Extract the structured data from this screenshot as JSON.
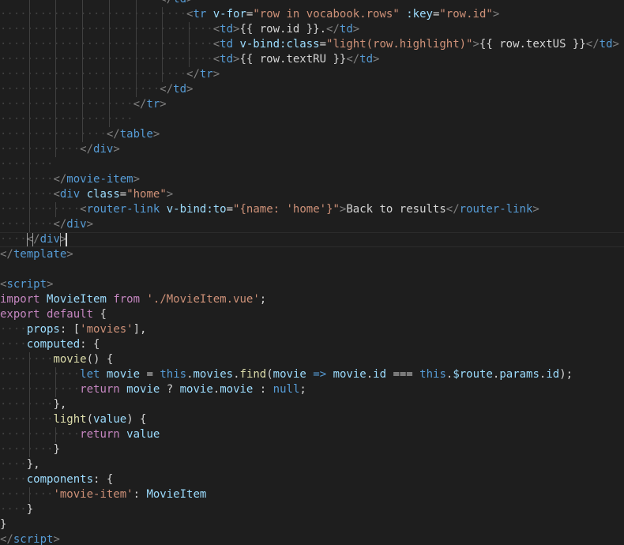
{
  "editor": {
    "language": "vue",
    "lines": [
      {
        "indent": 6,
        "tokens": [
          [
            "</",
            "tpunc"
          ],
          [
            "td",
            "ttag"
          ],
          [
            ">",
            "tpunc"
          ]
        ]
      },
      {
        "indent": 7,
        "tokens": [
          [
            "<",
            "tpunc"
          ],
          [
            "tr",
            "ttag"
          ],
          [
            " ",
            "ttxt"
          ],
          [
            "v-for",
            "tattr"
          ],
          [
            "=",
            "ttxt"
          ],
          [
            "\"row in vocabook.rows\"",
            "tstr"
          ],
          [
            " ",
            "ttxt"
          ],
          [
            ":key",
            "tattr"
          ],
          [
            "=",
            "ttxt"
          ],
          [
            "\"row.id\"",
            "tstr"
          ],
          [
            ">",
            "tpunc"
          ]
        ]
      },
      {
        "indent": 8,
        "tokens": [
          [
            "<",
            "tpunc"
          ],
          [
            "td",
            "ttag"
          ],
          [
            ">",
            "tpunc"
          ],
          [
            "{{ row.id }}.",
            "ttxt"
          ],
          [
            "</",
            "tpunc"
          ],
          [
            "td",
            "ttag"
          ],
          [
            ">",
            "tpunc"
          ]
        ]
      },
      {
        "indent": 8,
        "tokens": [
          [
            "<",
            "tpunc"
          ],
          [
            "td",
            "ttag"
          ],
          [
            " ",
            "ttxt"
          ],
          [
            "v-bind:class",
            "tattr"
          ],
          [
            "=",
            "ttxt"
          ],
          [
            "\"light(row.highlight)\"",
            "tstr"
          ],
          [
            ">",
            "tpunc"
          ],
          [
            "{{ row.textUS }}",
            "ttxt"
          ],
          [
            "</",
            "tpunc"
          ],
          [
            "td",
            "ttag"
          ],
          [
            ">",
            "tpunc"
          ]
        ]
      },
      {
        "indent": 8,
        "tokens": [
          [
            "<",
            "tpunc"
          ],
          [
            "td",
            "ttag"
          ],
          [
            ">",
            "tpunc"
          ],
          [
            "{{ row.textRU }}",
            "ttxt"
          ],
          [
            "</",
            "tpunc"
          ],
          [
            "td",
            "ttag"
          ],
          [
            ">",
            "tpunc"
          ]
        ]
      },
      {
        "indent": 7,
        "tokens": [
          [
            "</",
            "tpunc"
          ],
          [
            "tr",
            "ttag"
          ],
          [
            ">",
            "tpunc"
          ]
        ]
      },
      {
        "indent": 6,
        "tokens": [
          [
            "</",
            "tpunc"
          ],
          [
            "td",
            "ttag"
          ],
          [
            ">",
            "tpunc"
          ]
        ]
      },
      {
        "indent": 5,
        "tokens": [
          [
            "</",
            "tpunc"
          ],
          [
            "tr",
            "ttag"
          ],
          [
            ">",
            "tpunc"
          ]
        ]
      },
      {
        "indent": 5,
        "tokens": []
      },
      {
        "indent": 4,
        "tokens": [
          [
            "</",
            "tpunc"
          ],
          [
            "table",
            "ttag"
          ],
          [
            ">",
            "tpunc"
          ]
        ]
      },
      {
        "indent": 3,
        "tokens": [
          [
            "</",
            "tpunc"
          ],
          [
            "div",
            "ttag"
          ],
          [
            ">",
            "tpunc"
          ]
        ]
      },
      {
        "indent": 2,
        "tokens": []
      },
      {
        "indent": 2,
        "tokens": [
          [
            "</",
            "tpunc"
          ],
          [
            "movie-item",
            "ttag"
          ],
          [
            ">",
            "tpunc"
          ]
        ]
      },
      {
        "indent": 2,
        "tokens": [
          [
            "<",
            "tpunc"
          ],
          [
            "div",
            "ttag"
          ],
          [
            " ",
            "ttxt"
          ],
          [
            "class",
            "tattr"
          ],
          [
            "=",
            "ttxt"
          ],
          [
            "\"home\"",
            "tstr"
          ],
          [
            ">",
            "tpunc"
          ]
        ]
      },
      {
        "indent": 3,
        "tokens": [
          [
            "<",
            "tpunc"
          ],
          [
            "router-link",
            "ttag"
          ],
          [
            " ",
            "ttxt"
          ],
          [
            "v-bind:to",
            "tattr"
          ],
          [
            "=",
            "ttxt"
          ],
          [
            "\"{name: ",
            "tstr"
          ],
          [
            "'home'",
            "tstr"
          ],
          [
            "}\"",
            "tstr"
          ],
          [
            ">",
            "tpunc"
          ],
          [
            "Back to results",
            "ttxt"
          ],
          [
            "</",
            "tpunc"
          ],
          [
            "router-link",
            "ttag"
          ],
          [
            ">",
            "tpunc"
          ]
        ]
      },
      {
        "indent": 2,
        "tokens": [
          [
            "</",
            "tpunc"
          ],
          [
            "div",
            "ttag"
          ],
          [
            ">",
            "tpunc"
          ]
        ]
      },
      {
        "indent": 1,
        "active": true,
        "tokens": [
          [
            "</",
            "tpunc",
            "box"
          ],
          [
            "div",
            "ttag"
          ],
          [
            ">",
            "tpunc",
            "box-cursor"
          ]
        ]
      },
      {
        "indent": 0,
        "tokens": [
          [
            "</",
            "tpunc"
          ],
          [
            "template",
            "ttag"
          ],
          [
            ">",
            "tpunc"
          ]
        ]
      },
      {
        "indent": 0,
        "tokens": []
      },
      {
        "indent": 0,
        "tokens": [
          [
            "<",
            "tpunc"
          ],
          [
            "script",
            "ttag"
          ],
          [
            ">",
            "tpunc"
          ]
        ]
      },
      {
        "indent": 0,
        "tokens": [
          [
            "import",
            "tctl"
          ],
          [
            " ",
            "ttxt"
          ],
          [
            "MovieItem",
            "tvar"
          ],
          [
            " ",
            "ttxt"
          ],
          [
            "from",
            "tctl"
          ],
          [
            " ",
            "ttxt"
          ],
          [
            "'./MovieItem.vue'",
            "tstr"
          ],
          [
            ";",
            "ttxt"
          ]
        ]
      },
      {
        "indent": 0,
        "tokens": [
          [
            "export",
            "tctl"
          ],
          [
            " ",
            "ttxt"
          ],
          [
            "default",
            "tctl"
          ],
          [
            " {",
            "ttxt"
          ]
        ]
      },
      {
        "indent": 1,
        "tokens": [
          [
            "props",
            "tvar"
          ],
          [
            ": [",
            "ttxt"
          ],
          [
            "'movies'",
            "tstr"
          ],
          [
            "],",
            "ttxt"
          ]
        ]
      },
      {
        "indent": 1,
        "tokens": [
          [
            "computed",
            "tvar"
          ],
          [
            ": {",
            "ttxt"
          ]
        ]
      },
      {
        "indent": 2,
        "tokens": [
          [
            "movie",
            "tfn"
          ],
          [
            "() {",
            "ttxt"
          ]
        ]
      },
      {
        "indent": 3,
        "tokens": [
          [
            "let",
            "tkw"
          ],
          [
            " ",
            "ttxt"
          ],
          [
            "movie",
            "tvar"
          ],
          [
            " = ",
            "ttxt"
          ],
          [
            "this",
            "tkw"
          ],
          [
            ".",
            "ttxt"
          ],
          [
            "movies",
            "tvar"
          ],
          [
            ".",
            "ttxt"
          ],
          [
            "find",
            "tfn"
          ],
          [
            "(",
            "ttxt"
          ],
          [
            "movie",
            "tvar"
          ],
          [
            " ",
            "ttxt"
          ],
          [
            "=>",
            "tkw"
          ],
          [
            " ",
            "ttxt"
          ],
          [
            "movie",
            "tvar"
          ],
          [
            ".",
            "ttxt"
          ],
          [
            "id",
            "tvar"
          ],
          [
            " === ",
            "ttxt"
          ],
          [
            "this",
            "tkw"
          ],
          [
            ".",
            "ttxt"
          ],
          [
            "$route",
            "tvar"
          ],
          [
            ".",
            "ttxt"
          ],
          [
            "params",
            "tvar"
          ],
          [
            ".",
            "ttxt"
          ],
          [
            "id",
            "tvar"
          ],
          [
            ");",
            "ttxt"
          ]
        ]
      },
      {
        "indent": 3,
        "tokens": [
          [
            "return",
            "tctl"
          ],
          [
            " ",
            "ttxt"
          ],
          [
            "movie",
            "tvar"
          ],
          [
            " ? ",
            "ttxt"
          ],
          [
            "movie",
            "tvar"
          ],
          [
            ".",
            "ttxt"
          ],
          [
            "movie",
            "tvar"
          ],
          [
            " : ",
            "ttxt"
          ],
          [
            "null",
            "tkw"
          ],
          [
            ";",
            "ttxt"
          ]
        ]
      },
      {
        "indent": 2,
        "tokens": [
          [
            "},",
            "ttxt"
          ]
        ]
      },
      {
        "indent": 2,
        "tokens": [
          [
            "light",
            "tfn"
          ],
          [
            "(",
            "ttxt"
          ],
          [
            "value",
            "tvar"
          ],
          [
            ") {",
            "ttxt"
          ]
        ]
      },
      {
        "indent": 3,
        "tokens": [
          [
            "return",
            "tctl"
          ],
          [
            " ",
            "ttxt"
          ],
          [
            "value",
            "tvar"
          ]
        ]
      },
      {
        "indent": 2,
        "tokens": [
          [
            "}",
            "ttxt"
          ]
        ]
      },
      {
        "indent": 1,
        "tokens": [
          [
            "},",
            "ttxt"
          ]
        ]
      },
      {
        "indent": 1,
        "tokens": [
          [
            "components",
            "tvar"
          ],
          [
            ": {",
            "ttxt"
          ]
        ]
      },
      {
        "indent": 2,
        "tokens": [
          [
            "'movie-item'",
            "tstr"
          ],
          [
            ": ",
            "ttxt"
          ],
          [
            "MovieItem",
            "tvar"
          ]
        ]
      },
      {
        "indent": 1,
        "tokens": [
          [
            "}",
            "ttxt"
          ]
        ]
      },
      {
        "indent": 0,
        "tokens": [
          [
            "}",
            "ttxt"
          ]
        ]
      },
      {
        "indent": 0,
        "tokens": [
          [
            "</",
            "tpunc"
          ],
          [
            "script",
            "ttag"
          ],
          [
            ">",
            "tpunc"
          ]
        ]
      }
    ]
  }
}
